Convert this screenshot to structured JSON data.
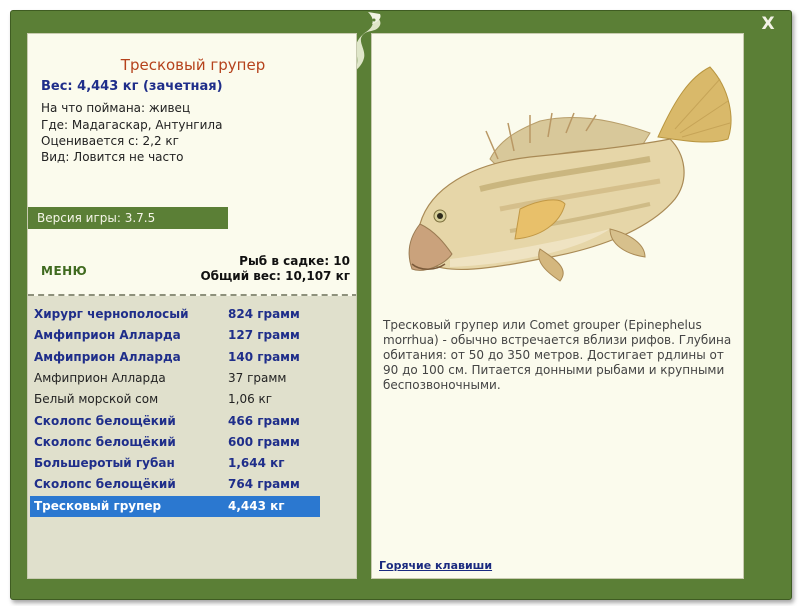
{
  "window": {
    "close_label": "X"
  },
  "fish": {
    "title": "Тресковый групер",
    "weight": "Вес: 4,443 кг (зачетная)",
    "details": [
      "На что поймана: живец",
      "Где: Мадагаскар, Антунгила",
      "Оценивается с: 2,2 кг",
      "Вид: Ловится не часто"
    ],
    "description": "Тресковый групер или Comet grouper (Epinephelus morrhua) - обычно встречается вблизи рифов. Глубина обитания: от 50 до 350 метров. Достигает рдлины от 90 до 100 см. Питается донными рыбами и крупными беспозвоночными."
  },
  "version": "Версия игры: 3.7.5",
  "menu_label": "МЕНЮ",
  "stats": {
    "count": "Рыб в садке: 10",
    "total": "Общий вес: 10,107 кг"
  },
  "catch": [
    {
      "name": "Хирург чернополосый",
      "weight": "824 грамм",
      "style": "bold"
    },
    {
      "name": "Амфиприон Алларда",
      "weight": "127 грамм",
      "style": "bold"
    },
    {
      "name": "Амфиприон Алларда",
      "weight": "140 грамм",
      "style": "bold"
    },
    {
      "name": "Амфиприон Алларда",
      "weight": "37 грамм",
      "style": "plain"
    },
    {
      "name": "Белый морской сом",
      "weight": "1,06 кг",
      "style": "plain"
    },
    {
      "name": "Сколопс белощёкий",
      "weight": "466 грамм",
      "style": "bold"
    },
    {
      "name": "Сколопс белощёкий",
      "weight": "600 грамм",
      "style": "bold"
    },
    {
      "name": "Большеротый губан",
      "weight": "1,644 кг",
      "style": "bold"
    },
    {
      "name": "Сколопс белощёкий",
      "weight": "764 грамм",
      "style": "bold"
    },
    {
      "name": "Тресковый групер",
      "weight": "4,443 кг",
      "style": "selected"
    }
  ],
  "hotkeys_label": "Горячие клавиши",
  "colors": {
    "frame_green": "#5b7f36",
    "panel_cream": "#fbfbed",
    "list_bg": "#e0e0cc",
    "selection_blue": "#2b78d0",
    "title_orange": "#b5421c",
    "bold_blue": "#1f2e8a"
  },
  "icons": [
    "close-icon",
    "fish-logo-icon",
    "grouper-fish-image"
  ]
}
